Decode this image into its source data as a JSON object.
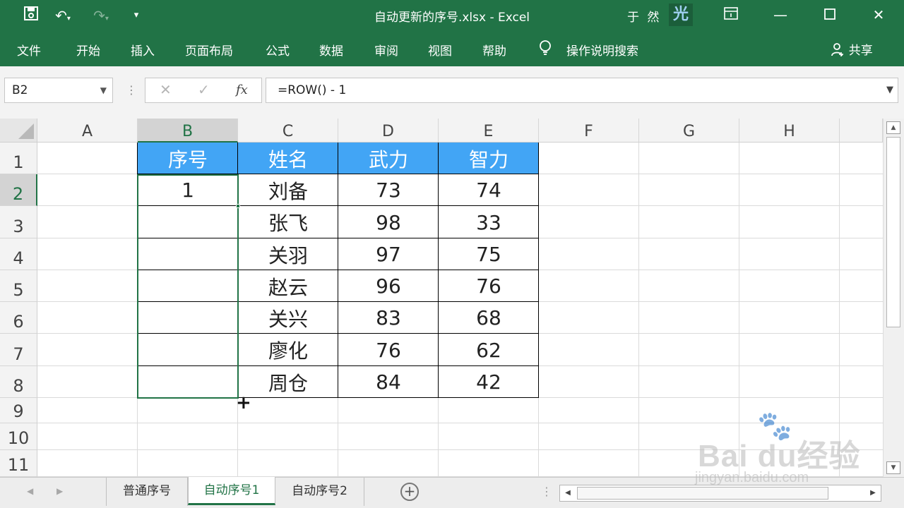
{
  "app": {
    "document_title": "自动更新的序号.xlsx  -  Excel",
    "user_name": "于 然",
    "user_avatar": "光"
  },
  "quick_access": {
    "save_icon": "save-icon",
    "undo_icon": "undo-icon",
    "redo_icon": "redo-icon",
    "customize_icon": "customize-icon"
  },
  "ribbon": {
    "tabs": [
      "文件",
      "开始",
      "插入",
      "页面布局",
      "公式",
      "数据",
      "审阅",
      "视图",
      "帮助"
    ],
    "tell_me": "操作说明搜索",
    "share": "共享"
  },
  "formula_bar": {
    "name_box": "B2",
    "cancel": "✕",
    "enter": "✓",
    "fx": "fx",
    "formula": "=ROW() - 1"
  },
  "columns": [
    "A",
    "B",
    "C",
    "D",
    "E",
    "F",
    "G",
    "H"
  ],
  "rows": [
    "1",
    "2",
    "3",
    "4",
    "5",
    "6",
    "7",
    "8",
    "9",
    "10",
    "11"
  ],
  "active_cell": {
    "column": "B",
    "row": "2"
  },
  "table": {
    "headers": [
      "序号",
      "姓名",
      "武力",
      "智力"
    ],
    "data": [
      [
        "1",
        "刘备",
        "73",
        "74"
      ],
      [
        "",
        "张飞",
        "98",
        "33"
      ],
      [
        "",
        "关羽",
        "97",
        "75"
      ],
      [
        "",
        "赵云",
        "96",
        "76"
      ],
      [
        "",
        "关兴",
        "83",
        "68"
      ],
      [
        "",
        "廖化",
        "76",
        "62"
      ],
      [
        "",
        "周仓",
        "84",
        "42"
      ]
    ],
    "header_color": "#42a5f5"
  },
  "sheet_tabs": [
    "普通序号",
    "自动序号1",
    "自动序号2"
  ],
  "active_sheet": "自动序号1",
  "watermark": {
    "logo": "Bai  du经验",
    "url": "jingyan.baidu.com"
  },
  "colors": {
    "accent": "#217346",
    "grid_line": "#dadada"
  }
}
